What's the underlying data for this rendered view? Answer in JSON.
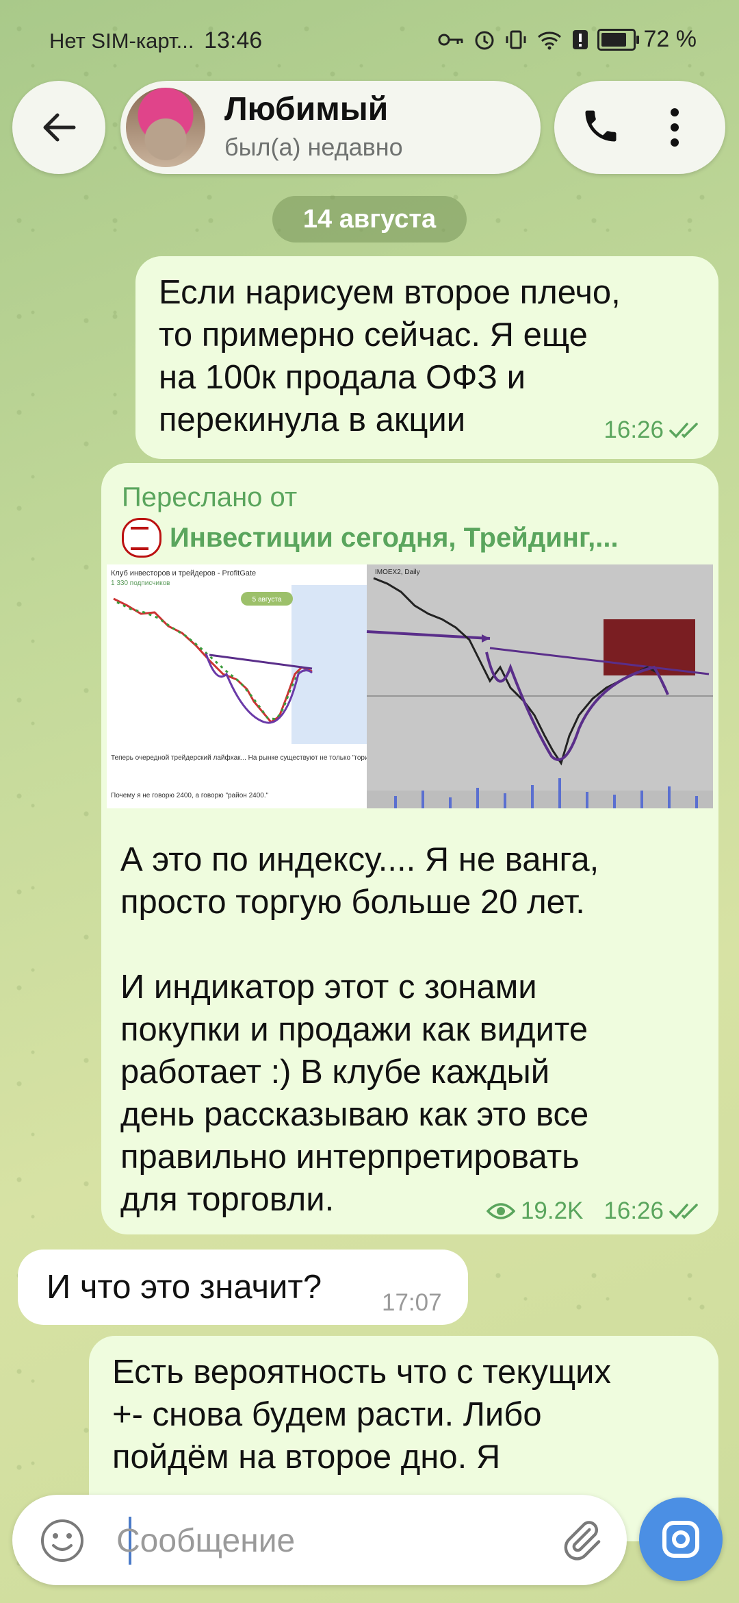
{
  "status_bar": {
    "carrier": "Нет SIM-карт...",
    "time": "13:46",
    "battery_percent_label": "72 %",
    "battery_level": 0.72
  },
  "header": {
    "contact_name": "Любимый",
    "contact_status": "был(а) недавно",
    "icons": [
      "back-arrow-icon",
      "phone-icon",
      "more-vertical-icon"
    ]
  },
  "date_separator": "14 августа",
  "messages": [
    {
      "direction": "outgoing",
      "text": "Если нарисуем второе плечо,\nто примерно сейчас. Я еще\nна 100к продала ОФЗ и\nперекинула в акции",
      "time": "16:26",
      "read": true
    },
    {
      "direction": "outgoing",
      "forwarded_label": "Переслано от",
      "forwarded_from": "Инвестиции сегодня, Трейдинг,...",
      "media": {
        "left_title": "Клуб инвесторов и трейдеров - ProfitGate",
        "left_subscribers": "1 330 подписчиков",
        "left_badge": "5 августа",
        "left_caption_1": "Теперь очередной трейдерский лайфхак... На рынке существуют не только \"горизонтальные\" уровни. Но как вы в курсе по симметриям, которые у нас работают, есть ещё наклонные.",
        "left_caption_2": "Почему  я не говорю 2400, а говорю \"район 2400.\"",
        "right_title": "IMOEX2, Daily"
      },
      "text": "А это по индексу.... Я не ванга,\nпросто торгую больше 20 лет.\n\nИ индикатор этот с зонами\nпокупки и продажи как видите\nработает :) В клубе каждый\nдень рассказываю как это все\nправильно интерпретировать\nдля торговли.",
      "views": "19.2K",
      "time": "16:26",
      "read": true
    },
    {
      "direction": "incoming",
      "text": "И что это значит?",
      "time": "17:07"
    },
    {
      "direction": "outgoing",
      "text": "Есть вероятность что с текущих\n+- снова будем расти. Либо\nпойдём на второе дно. Я"
    }
  ],
  "composer": {
    "placeholder": "Сообщение",
    "icons": [
      "emoji-icon",
      "attach-icon",
      "camera-icon"
    ]
  },
  "colors": {
    "outgoing_bubble": "#effcde",
    "incoming_bubble": "#ffffff",
    "accent_green": "#5aa55d",
    "send_button": "#4b8fe4"
  }
}
